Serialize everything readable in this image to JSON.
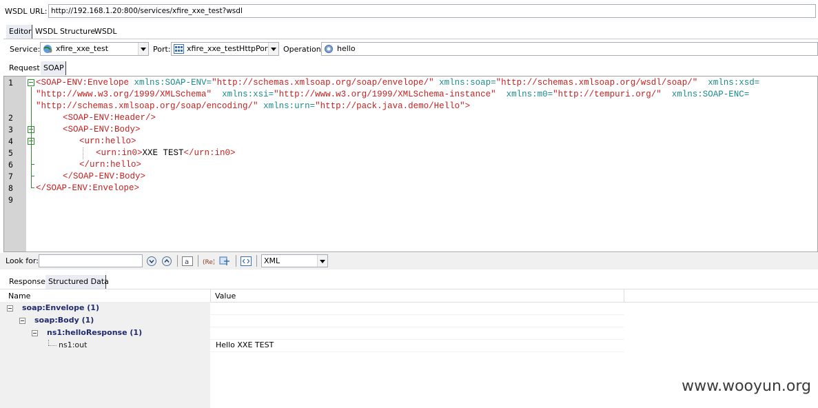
{
  "wsdl_bar": {
    "label": "WSDL URL:",
    "url": "http://192.168.1.20:800/services/xfire_xxe_test?wsdl"
  },
  "top_tabs": [
    "Editor",
    "WSDL Structure",
    "WSDL"
  ],
  "service_row": {
    "service_label": "Service:",
    "service_value": "xfire_xxe_test",
    "port_label": "Port:",
    "port_value": "xfire_xxe_testHttpPort",
    "operation_label": "Operation:",
    "operation_value": "hello"
  },
  "request_tabs": [
    "Request",
    "SOAP"
  ],
  "editor": {
    "line_numbers": [
      "1",
      "2",
      "3",
      "4",
      "5",
      "6",
      "7",
      "8",
      "9"
    ],
    "lines": [
      [
        [
          "t",
          "<SOAP-ENV:Envelope "
        ],
        [
          "a",
          "xmlns:SOAP-ENV="
        ],
        [
          "v",
          "\"http://schemas.xmlsoap.org/soap/envelope/\""
        ],
        [
          "p",
          " "
        ],
        [
          "a",
          "xmlns:soap="
        ],
        [
          "v",
          "\"http://schemas.xmlsoap.org/wsdl/soap/\""
        ],
        [
          "p",
          "  "
        ],
        [
          "a",
          "xmlns:xsd="
        ]
      ],
      [
        [
          "v",
          "\"http://www.w3.org/1999/XMLSchema\""
        ],
        [
          "p",
          "  "
        ],
        [
          "a",
          "xmlns:xsi="
        ],
        [
          "v",
          "\"http://www.w3.org/1999/XMLSchema-instance\""
        ],
        [
          "p",
          "  "
        ],
        [
          "a",
          "xmlns:m0="
        ],
        [
          "v",
          "\"http://tempuri.org/\""
        ],
        [
          "p",
          "  "
        ],
        [
          "a",
          "xmlns:SOAP-ENC="
        ]
      ],
      [
        [
          "v",
          "\"http://schemas.xmlsoap.org/soap/encoding/\""
        ],
        [
          "p",
          " "
        ],
        [
          "a",
          "xmlns:urn="
        ],
        [
          "v",
          "\"http://pack.java.demo/Hello\""
        ],
        [
          "t",
          ">"
        ]
      ],
      [
        [
          "t",
          "<SOAP-ENV:Header/>"
        ]
      ],
      [
        [
          "t",
          "<SOAP-ENV:Body>"
        ]
      ],
      [
        [
          "t",
          "<urn:hello>"
        ]
      ],
      [
        [
          "t",
          "<urn:in0>"
        ],
        [
          "p",
          "XXE TEST"
        ],
        [
          "t",
          "</urn:in0>"
        ]
      ],
      [
        [
          "t",
          "</urn:hello>"
        ]
      ],
      [
        [
          "t",
          "</SOAP-ENV:Body>"
        ]
      ],
      [
        [
          "t",
          "</SOAP-ENV:Envelope>"
        ]
      ]
    ]
  },
  "search_bar": {
    "label": "Look for:",
    "query": "",
    "format_value": "XML"
  },
  "response_tabs": [
    "Response",
    "Structured Data"
  ],
  "structured_data": {
    "col_name": "Name",
    "col_value": "Value",
    "rows": [
      {
        "name": "soap:Envelope (1)",
        "value": ""
      },
      {
        "name": "soap:Body (1)",
        "value": ""
      },
      {
        "name": "ns1:helloResponse (1)",
        "value": ""
      },
      {
        "name": "ns1:out",
        "value": "Hello XXE TEST"
      }
    ]
  },
  "watermark": "www.wooyun.org"
}
